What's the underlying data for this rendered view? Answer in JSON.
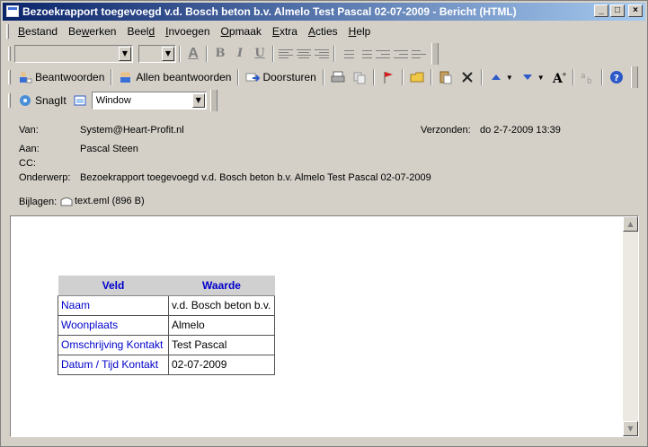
{
  "window": {
    "title": "Bezoekrapport toegevoegd  v.d. Bosch beton b.v.  Almelo  Test Pascal  02-07-2009 - Bericht (HTML)",
    "minimize": "_",
    "maximize": "□",
    "close": "×"
  },
  "menu": {
    "items": [
      {
        "pre": "",
        "u": "B",
        "post": "estand"
      },
      {
        "pre": "Be",
        "u": "w",
        "post": "erken"
      },
      {
        "pre": "Beel",
        "u": "d",
        "post": ""
      },
      {
        "pre": "",
        "u": "I",
        "post": "nvoegen"
      },
      {
        "pre": "",
        "u": "O",
        "post": "pmaak"
      },
      {
        "pre": "",
        "u": "E",
        "post": "xtra"
      },
      {
        "pre": "",
        "u": "A",
        "post": "cties"
      },
      {
        "pre": "",
        "u": "H",
        "post": "elp"
      }
    ]
  },
  "toolbar_format": {
    "bold": "B",
    "italic": "I",
    "underline": "U",
    "font_color": "A"
  },
  "toolbar_actions": {
    "reply": "Beantwoorden",
    "reply_all": "Allen beantwoorden",
    "forward": "Doorsturen"
  },
  "toolbar_snagit": {
    "snagit": "SnagIt",
    "window_combo": "Window"
  },
  "header": {
    "from_label": "Van:",
    "from_value": "System@Heart-Profit.nl",
    "sent_label": "Verzonden:",
    "sent_value": "do 2-7-2009 13:39",
    "to_label": "Aan:",
    "to_value": "Pascal Steen",
    "cc_label": "CC:",
    "cc_value": "",
    "subject_label": "Onderwerp:",
    "subject_value": "Bezoekrapport toegevoegd  v.d. Bosch beton b.v.  Almelo  Test Pascal  02-07-2009",
    "attach_label": "Bijlagen:",
    "attach_value": "text.eml (896 B)"
  },
  "report": {
    "headers": [
      "Veld",
      "Waarde"
    ],
    "rows": [
      [
        "Naam",
        "v.d. Bosch beton b.v."
      ],
      [
        "Woonplaats",
        "Almelo"
      ],
      [
        "Omschrijving Kontakt",
        "Test Pascal"
      ],
      [
        "Datum / Tijd Kontakt",
        "02-07-2009"
      ]
    ]
  },
  "colors": {
    "titlebar_start": "#0a246a",
    "titlebar_end": "#a6caf0",
    "field_label": "#0000cc",
    "chrome": "#d4d0c8"
  }
}
